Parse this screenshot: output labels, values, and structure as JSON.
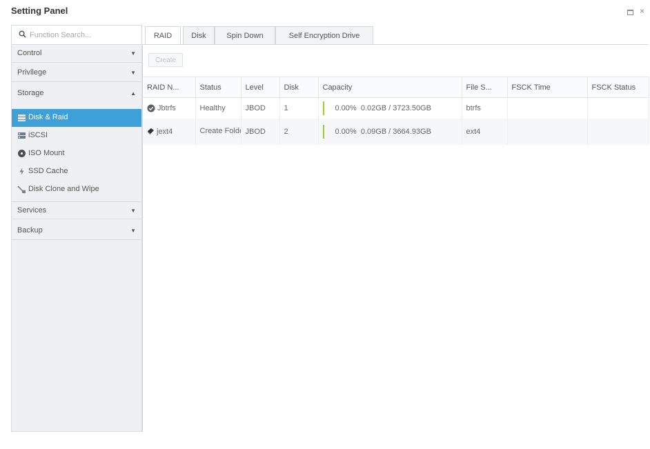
{
  "window": {
    "title": "Setting Panel",
    "restore_icon": "restore-icon",
    "close_glyph": "×"
  },
  "sidebar": {
    "search": {
      "placeholder": "Function Search...",
      "icon": "search-icon"
    },
    "categories": [
      {
        "label": "Control",
        "arrow": "▼",
        "expanded": false
      },
      {
        "label": "Privilege",
        "arrow": "▼",
        "expanded": false
      },
      {
        "label": "Storage",
        "arrow": "▲",
        "expanded": true
      },
      {
        "label": "Services",
        "arrow": "▼",
        "expanded": false
      },
      {
        "label": "Backup",
        "arrow": "▼",
        "expanded": false
      }
    ],
    "storage_items": [
      {
        "label": "Disk & Raid",
        "icon": "disk-raid-icon",
        "active": true
      },
      {
        "label": "iSCSI",
        "icon": "iscsi-icon",
        "active": false
      },
      {
        "label": "ISO Mount",
        "icon": "iso-mount-icon",
        "active": false
      },
      {
        "label": "SSD Cache",
        "icon": "ssd-cache-icon",
        "active": false
      },
      {
        "label": "Disk Clone and Wipe",
        "icon": "disk-clone-icon",
        "active": false
      }
    ]
  },
  "tabs": [
    {
      "label": "RAID",
      "active": true
    },
    {
      "label": "Disk",
      "active": false
    },
    {
      "label": "Spin Down",
      "active": false
    },
    {
      "label": "Self Encryption Drive",
      "active": false
    }
  ],
  "toolbar": {
    "create_label": "Create",
    "create_enabled": false
  },
  "table": {
    "columns": [
      "RAID N...",
      "Status",
      "Level",
      "Disk",
      "Capacity",
      "File S...",
      "FSCK Time",
      "FSCK Status"
    ],
    "rows": [
      {
        "name": "Jbtrfs",
        "name_icon": "check-circle-icon",
        "status": "Healthy",
        "level": "JBOD",
        "disk": "1",
        "capacity_pct": "0.00%",
        "capacity": "0.02GB / 3723.50GB",
        "fs": "btrfs",
        "fsck_time": "",
        "fsck_status": ""
      },
      {
        "name": "jext4",
        "name_icon": "disk-drive-icon",
        "status": "Create Folder",
        "level": "JBOD",
        "disk": "2",
        "capacity_pct": "0.00%",
        "capacity": "0.09GB / 3664.93GB",
        "fs": "ext4",
        "fsck_time": "",
        "fsck_status": ""
      }
    ]
  },
  "colors": {
    "active_item_bg": "#3ea0d8",
    "capacity_bar": "#9acd32",
    "sidebar_bg": "#eef0f3"
  }
}
